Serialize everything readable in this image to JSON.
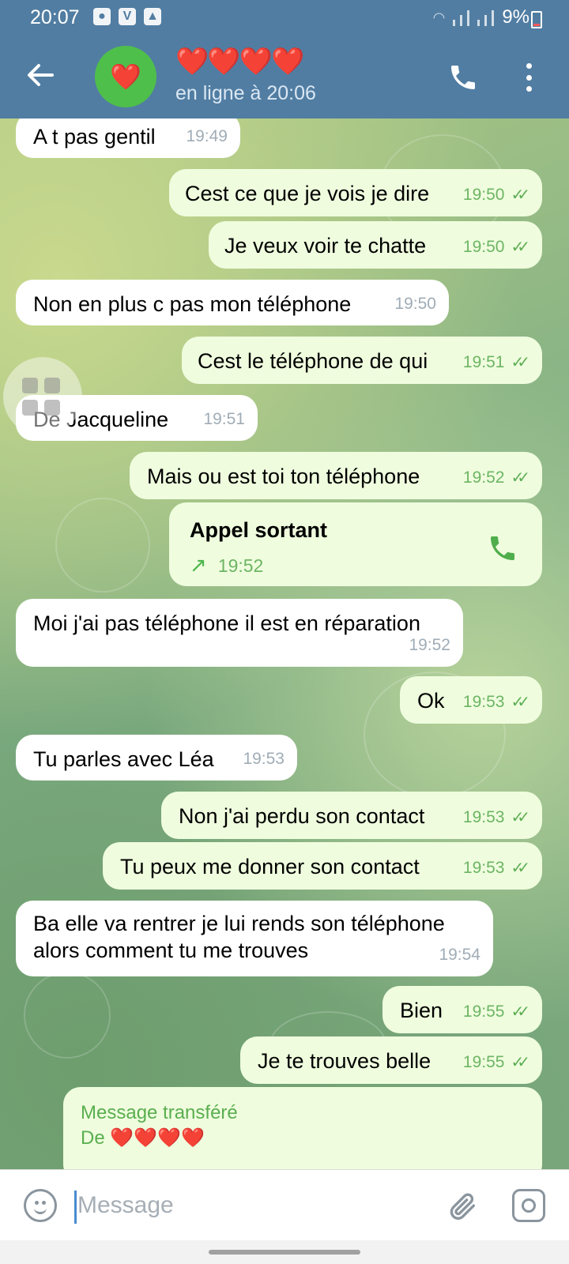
{
  "status_bar": {
    "time": "20:07",
    "icons": [
      "shield-icon",
      "v-app-icon",
      "gallery-icon"
    ],
    "battery": "9%"
  },
  "header": {
    "title": "❤️❤️❤️❤️",
    "subtitle": "en ligne à 20:06",
    "avatar": "❤️"
  },
  "messages": [
    {
      "dir": "in",
      "text": "A t pas gentil",
      "time": "19:49"
    },
    {
      "dir": "out",
      "text": "Cest ce que je vois je dire",
      "time": "19:50"
    },
    {
      "dir": "out",
      "text": "Je veux voir te chatte",
      "time": "19:50"
    },
    {
      "dir": "in",
      "text": "Non en plus c pas mon téléphone",
      "time": "19:50"
    },
    {
      "dir": "out",
      "text": "Cest le téléphone de qui",
      "time": "19:51"
    },
    {
      "dir": "in",
      "text": "De  Jacqueline",
      "time": "19:51"
    },
    {
      "dir": "out",
      "text": "Mais ou est toi ton téléphone",
      "time": "19:52"
    },
    {
      "dir": "out",
      "type": "call",
      "text": "Appel sortant",
      "time": "19:52"
    },
    {
      "dir": "in",
      "text": "Moi j'ai pas téléphone il est en réparation",
      "time": "19:52"
    },
    {
      "dir": "out",
      "text": "Ok",
      "time": "19:53"
    },
    {
      "dir": "in",
      "text": "Tu parles avec Léa",
      "time": "19:53"
    },
    {
      "dir": "out",
      "text": "Non j'ai perdu son contact",
      "time": "19:53"
    },
    {
      "dir": "out",
      "text": "Tu peux me donner son contact",
      "time": "19:53"
    },
    {
      "dir": "in",
      "text": "Ba elle va rentrer je lui rends son téléphone alors comment tu me trouves",
      "time": "19:54"
    },
    {
      "dir": "out",
      "text": "Bien",
      "time": "19:55"
    },
    {
      "dir": "out",
      "text": "Je te trouves belle",
      "time": "19:55"
    },
    {
      "dir": "out",
      "type": "forwarded",
      "label": "Message transféré",
      "from": "De ❤️❤️❤️❤️"
    }
  ],
  "input": {
    "placeholder": "Message"
  }
}
